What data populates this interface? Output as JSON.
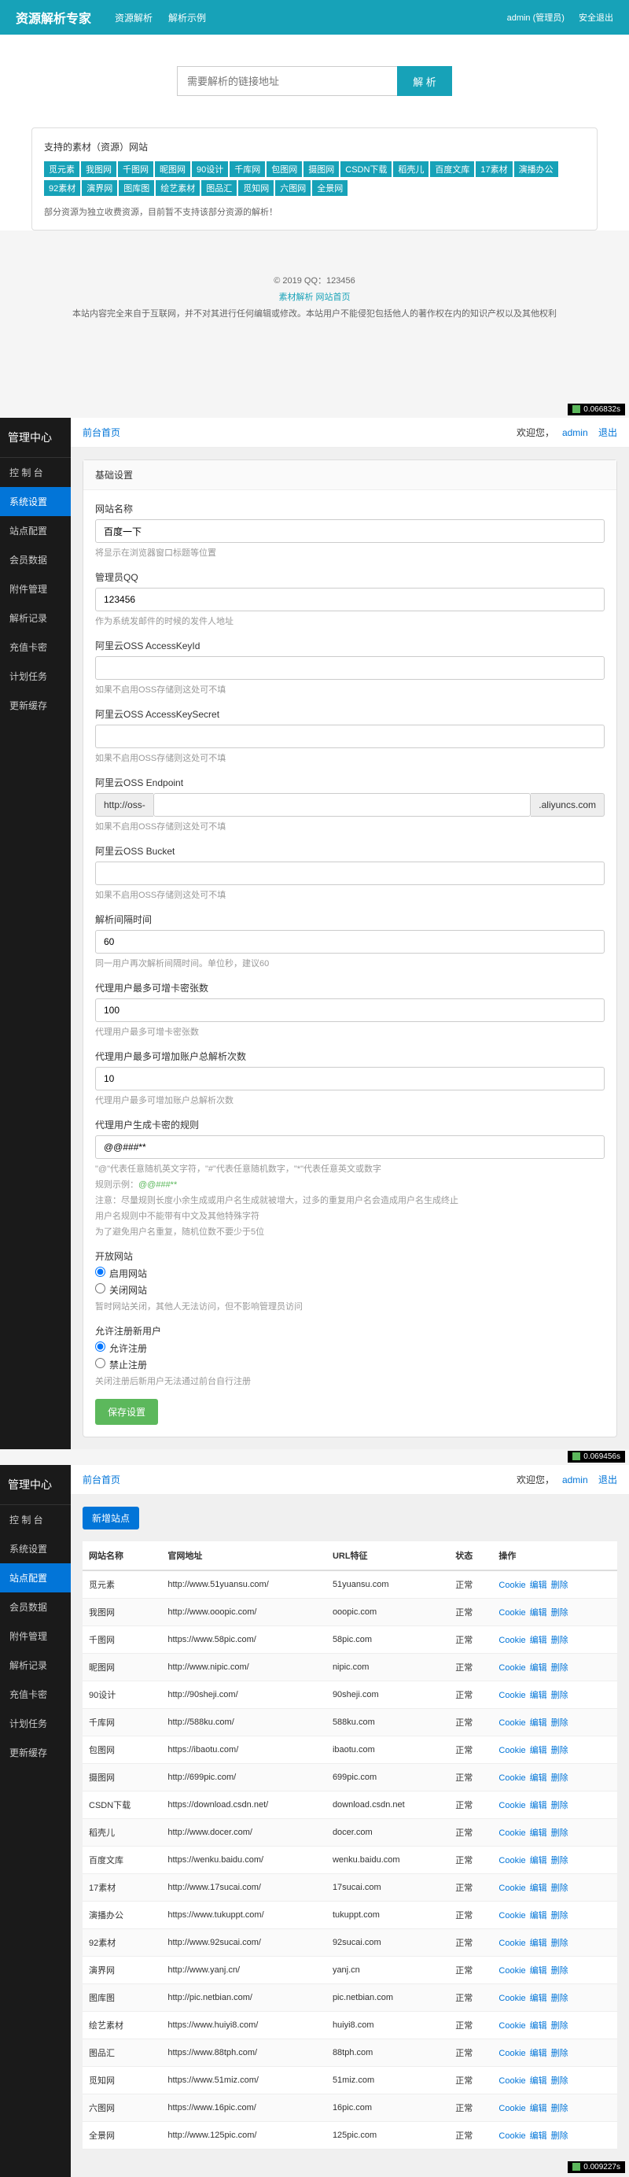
{
  "top": {
    "brand": "资源解析专家",
    "nav1": "资源解析",
    "nav2": "解析示例",
    "user": "admin (管理员)",
    "logout": "安全退出",
    "search_ph": "需要解析的链接地址",
    "search_btn": "解 析",
    "support_title": "支持的素材（资源）网站",
    "tags": [
      "觅元素",
      "我图网",
      "千图网",
      "昵图网",
      "90设计",
      "千库网",
      "包图网",
      "摄图网",
      "CSDN下载",
      "稻壳儿",
      "百度文库",
      "17素材",
      "演播办公",
      "92素材",
      "演界网",
      "图库图",
      "绘艺素材",
      "图品汇",
      "觅知网",
      "六图网",
      "全景网"
    ],
    "support_note": "部分资源为独立收费资源，目前暂不支持该部分资源的解析！"
  },
  "footer1": {
    "copy": "© 2019 QQ：123456",
    "links": "素材解析 网站首页",
    "disc": "本站内容完全来自于互联网，并不对其进行任何编辑或修改。本站用户不能侵犯包括他人的著作权在内的知识产权以及其他权利"
  },
  "sidebar_title": "管理中心",
  "menu": [
    "控 制 台",
    "系统设置",
    "站点配置",
    "会员数据",
    "附件管理",
    "解析记录",
    "充值卡密",
    "计划任务",
    "更新缓存"
  ],
  "menu2": [
    "控 制 台",
    "系统设置",
    "站点配置",
    "会员数据",
    "附件管理",
    "解析记录",
    "充值卡密",
    "计划任务",
    "更新缓存"
  ],
  "bc": "前台首页",
  "greet": "欢迎您，",
  "greet_user": "admin",
  "exit": "退出",
  "perf1": "0.066832s",
  "perf2": "0.069456s",
  "perf3": "0.009227s",
  "panel1_title": "基础设置",
  "form": {
    "f1_l": "网站名称",
    "f1_v": "百度一下",
    "f1_h": "将显示在浏览器窗口标题等位置",
    "f2_l": "管理员QQ",
    "f2_v": "123456",
    "f2_h": "作为系统发邮件的时候的发件人地址",
    "f3_l": "阿里云OSS AccessKeyId",
    "f3_h": "如果不启用OSS存储则这处可不填",
    "f4_l": "阿里云OSS AccessKeySecret",
    "f4_h": "如果不启用OSS存储则这处可不填",
    "f5_l": "阿里云OSS Endpoint",
    "f5_pre": "http://oss-",
    "f5_suf": ".aliyuncs.com",
    "f5_h": "如果不启用OSS存储则这处可不填",
    "f6_l": "阿里云OSS Bucket",
    "f6_h": "如果不启用OSS存储则这处可不填",
    "f7_l": "解析间隔时间",
    "f7_v": "60",
    "f7_h": "同一用户再次解析间隔时间。单位秒，建议60",
    "f8_l": "代理用户最多可增卡密张数",
    "f8_v": "100",
    "f8_h": "代理用户最多可增卡密张数",
    "f9_l": "代理用户最多可增加账户总解析次数",
    "f9_v": "10",
    "f9_h": "代理用户最多可增加账户总解析次数",
    "f10_l": "代理用户生成卡密的规则",
    "f10_v": "@@###**",
    "f10_h1": "\"@\"代表任意随机英文字符，\"#\"代表任意随机数字，\"*\"代表任意英文或数字",
    "f10_h2": "规则示例：",
    "f10_h3": "注意：尽量规则长度小余生成或用户名生成就被增大，过多的重复用户名会造成用户名生成终止",
    "f10_h4": "用户名规则中不能带有中文及其他特殊字符",
    "f10_h5": "为了避免用户名重复，随机位数不要少于5位",
    "g1_l": "开放网站",
    "g1_o1": "启用网站",
    "g1_o2": "关闭网站",
    "g1_h": "暂时网站关闭，其他人无法访问，但不影响管理员访问",
    "g2_l": "允许注册新用户",
    "g2_o1": "允许注册",
    "g2_o2": "禁止注册",
    "g2_h": "关闭注册后新用户无法通过前台自行注册",
    "save": "保存设置"
  },
  "add_btn": "新增站点",
  "thead": [
    "网站名称",
    "官网地址",
    "URL特征",
    "状态",
    "操作"
  ],
  "status_ok": "正常",
  "act1": "Cookie",
  "act2": "编辑",
  "act3": "删除",
  "sites": [
    {
      "n": "觅元素",
      "u": "http://www.51yuansu.com/",
      "h": "51yuansu.com"
    },
    {
      "n": "我图网",
      "u": "http://www.ooopic.com/",
      "h": "ooopic.com"
    },
    {
      "n": "千图网",
      "u": "https://www.58pic.com/",
      "h": "58pic.com"
    },
    {
      "n": "昵图网",
      "u": "http://www.nipic.com/",
      "h": "nipic.com"
    },
    {
      "n": "90设计",
      "u": "http://90sheji.com/",
      "h": "90sheji.com"
    },
    {
      "n": "千库网",
      "u": "http://588ku.com/",
      "h": "588ku.com"
    },
    {
      "n": "包图网",
      "u": "https://ibaotu.com/",
      "h": "ibaotu.com"
    },
    {
      "n": "摄图网",
      "u": "http://699pic.com/",
      "h": "699pic.com"
    },
    {
      "n": "CSDN下载",
      "u": "https://download.csdn.net/",
      "h": "download.csdn.net"
    },
    {
      "n": "稻壳儿",
      "u": "http://www.docer.com/",
      "h": "docer.com"
    },
    {
      "n": "百度文库",
      "u": "https://wenku.baidu.com/",
      "h": "wenku.baidu.com"
    },
    {
      "n": "17素材",
      "u": "http://www.17sucai.com/",
      "h": "17sucai.com"
    },
    {
      "n": "演播办公",
      "u": "https://www.tukuppt.com/",
      "h": "tukuppt.com"
    },
    {
      "n": "92素材",
      "u": "http://www.92sucai.com/",
      "h": "92sucai.com"
    },
    {
      "n": "演界网",
      "u": "http://www.yanj.cn/",
      "h": "yanj.cn"
    },
    {
      "n": "图库图",
      "u": "http://pic.netbian.com/",
      "h": "pic.netbian.com"
    },
    {
      "n": "绘艺素材",
      "u": "https://www.huiyi8.com/",
      "h": "huiyi8.com"
    },
    {
      "n": "图品汇",
      "u": "https://www.88tph.com/",
      "h": "88tph.com"
    },
    {
      "n": "觅知网",
      "u": "https://www.51miz.com/",
      "h": "51miz.com"
    },
    {
      "n": "六图网",
      "u": "https://www.16pic.com/",
      "h": "16pic.com"
    },
    {
      "n": "全景网",
      "u": "http://www.125pic.com/",
      "h": "125pic.com"
    }
  ]
}
